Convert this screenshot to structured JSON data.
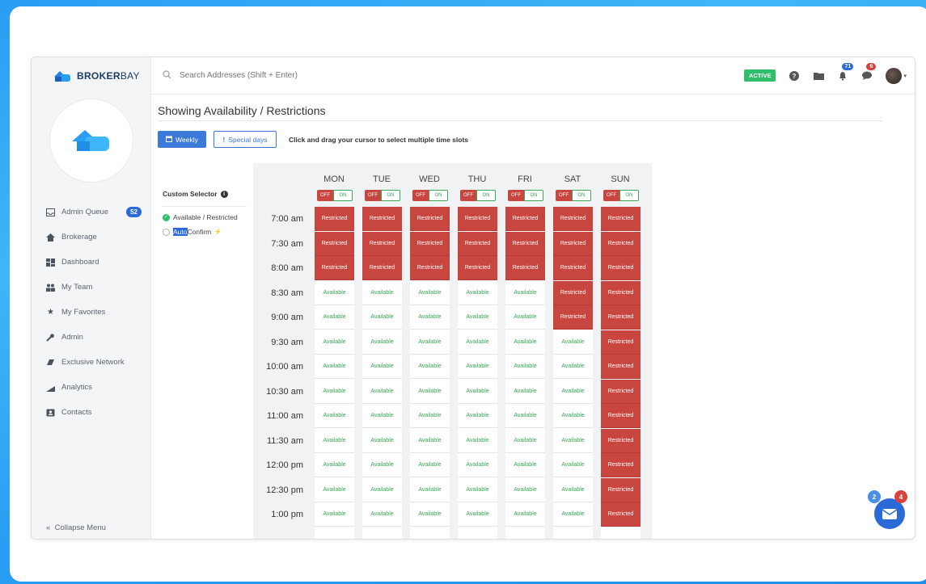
{
  "brand": {
    "name_bold": "BROKER",
    "name_thin": "BAY"
  },
  "search": {
    "placeholder": "Search Addresses (Shift + Enter)"
  },
  "topbar": {
    "status": "ACTIVE",
    "notification_count": "71",
    "message_count": "6"
  },
  "sidebar": {
    "items": [
      {
        "label": "Admin Queue",
        "icon": "inbox-icon",
        "badge": "52"
      },
      {
        "label": "Brokerage",
        "icon": "house-icon"
      },
      {
        "label": "Dashboard",
        "icon": "dashboard-icon"
      },
      {
        "label": "My Team",
        "icon": "team-icon"
      },
      {
        "label": "My Favorites",
        "icon": "star-icon"
      },
      {
        "label": "Admin",
        "icon": "wrench-icon"
      },
      {
        "label": "Exclusive Network",
        "icon": "network-icon"
      },
      {
        "label": "Analytics",
        "icon": "analytics-icon"
      },
      {
        "label": "Contacts",
        "icon": "contacts-icon"
      }
    ],
    "collapse_label": "Collapse Menu"
  },
  "page": {
    "title": "Showing Availability / Restrictions",
    "weekly_label": "Weekly",
    "special_days_label": "Special days",
    "hint": "Click and drag your cursor to select multiple time slots"
  },
  "selector": {
    "title": "Custom Selector",
    "option_available": "Available / Restricted",
    "option_auto_highlight": "Auto",
    "option_auto_rest": "Confirm"
  },
  "schedule": {
    "toggle_off": "OFF",
    "toggle_on": "ON",
    "days": [
      "MON",
      "TUE",
      "WED",
      "THU",
      "FRI",
      "SAT",
      "SUN"
    ],
    "times": [
      "7:00 am",
      "7:30 am",
      "8:00 am",
      "8:30 am",
      "9:00 am",
      "9:30 am",
      "10:00 am",
      "10:30 am",
      "11:00 am",
      "11:30 am",
      "12:00 pm",
      "12:30 pm",
      "1:00 pm"
    ],
    "restricted_label": "Restricted",
    "available_label": "Available",
    "restricted_until": [
      3,
      3,
      3,
      3,
      3,
      5,
      13
    ]
  },
  "chat": {
    "left_count": "2",
    "right_count": "4"
  },
  "colors": {
    "restricted": "#c9453f",
    "available_text": "#3aa757",
    "primary": "#2a6ad8",
    "active": "#2fbf6a"
  }
}
